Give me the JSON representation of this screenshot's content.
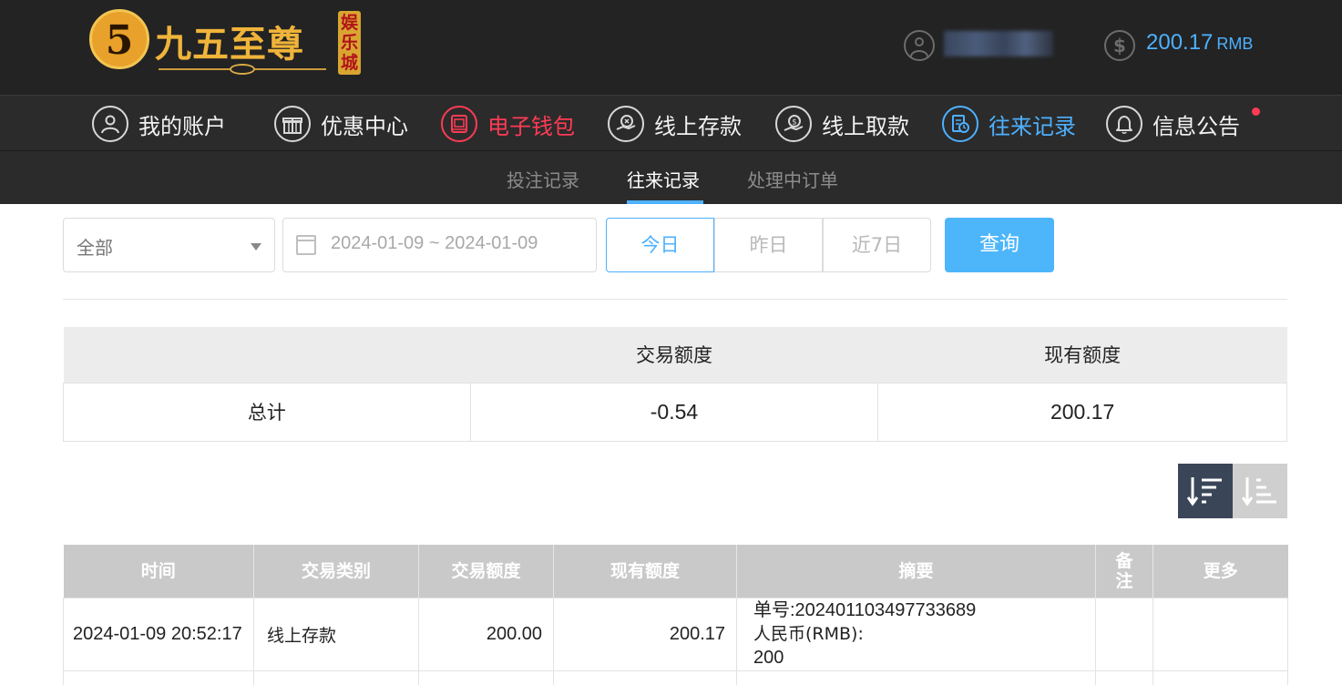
{
  "header": {
    "logo": {
      "emblem": "5",
      "name": "九五至尊",
      "tag": "娱乐城"
    },
    "balance": {
      "amount": "200.17",
      "currency": "RMB"
    }
  },
  "main_nav": [
    {
      "label": "我的账户",
      "icon": "user-icon"
    },
    {
      "label": "优惠中心",
      "icon": "gift-icon"
    },
    {
      "label": "电子钱包",
      "icon": "wallet-icon"
    },
    {
      "label": "线上存款",
      "icon": "deposit-icon"
    },
    {
      "label": "线上取款",
      "icon": "withdraw-icon"
    },
    {
      "label": "往来记录",
      "icon": "records-icon"
    },
    {
      "label": "信息公告",
      "icon": "bell-icon"
    }
  ],
  "sub_nav": [
    {
      "label": "投注记录"
    },
    {
      "label": "往来记录"
    },
    {
      "label": "处理中订单"
    }
  ],
  "filters": {
    "type_select": "全部",
    "date_range": "2024-01-09 ~ 2024-01-09",
    "ranges": [
      "今日",
      "昨日",
      "近7日"
    ],
    "query_label": "查询"
  },
  "summary": {
    "headers": [
      "",
      "交易额度",
      "现有额度"
    ],
    "row": {
      "label": "总计",
      "transaction": "-0.54",
      "current": "200.17"
    }
  },
  "records": {
    "headers": [
      "时间",
      "交易类别",
      "交易额度",
      "现有额度",
      "摘要",
      "备注",
      "更多"
    ],
    "rows": [
      {
        "time": "2024-01-09 20:52:17",
        "type": "线上存款",
        "amount": "200.00",
        "balance": "200.17",
        "summary_line1": "单号:202401103497733689",
        "summary_line2": "人民币(RMB):",
        "summary_line3": "200",
        "remark": "",
        "more": ""
      }
    ]
  },
  "colors": {
    "header_bg": "#232323",
    "nav_bg": "#2b2b2b",
    "accent_blue": "#4db1ff",
    "accent_red": "#ff3b55",
    "table_header_bg": "#c9c9c9"
  }
}
